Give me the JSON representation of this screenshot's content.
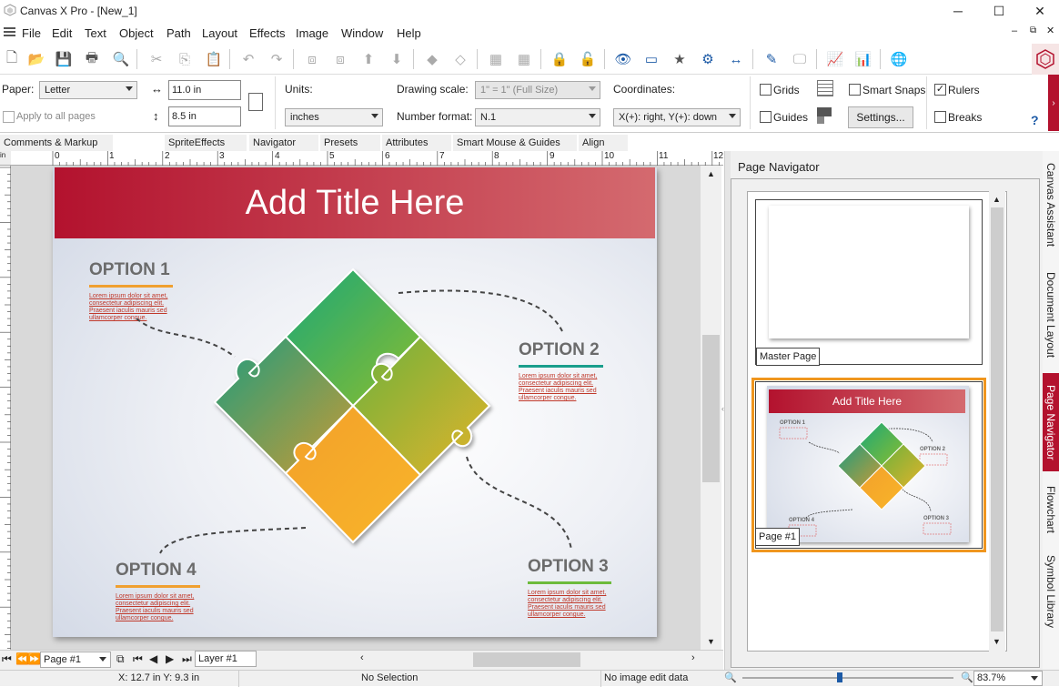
{
  "app": {
    "title": "Canvas X Pro - [New_1]"
  },
  "menu": [
    "File",
    "Edit",
    "Text",
    "Object",
    "Path",
    "Layout",
    "Effects",
    "Image",
    "Window",
    "Help"
  ],
  "props": {
    "paper_label": "Paper:",
    "paper_value": "Letter",
    "width_value": "11.0 in",
    "height_value": "8.5 in",
    "apply_all": "Apply to all pages",
    "units_label": "Units:",
    "units_value": "inches",
    "drawing_scale_label": "Drawing scale:",
    "drawing_scale_value": "1\" = 1\"  (Full Size)",
    "number_format_label": "Number format:",
    "number_format_value": "N.1",
    "coordinates_label": "Coordinates:",
    "coordinates_value": "X(+): right, Y(+): down",
    "grids": "Grids",
    "guides": "Guides",
    "smart_snaps": "Smart Snaps",
    "settings": "Settings...",
    "rulers": "Rulers",
    "breaks": "Breaks",
    "help": "?"
  },
  "panel_tabs": [
    "Comments & Markup",
    "SpriteEffects",
    "Navigator",
    "Presets",
    "Attributes",
    "Smart Mouse & Guides",
    "Align"
  ],
  "ruler_numbers": [
    "0",
    "1",
    "2",
    "3",
    "4",
    "5",
    "6",
    "7",
    "8",
    "9",
    "10",
    "11",
    "12"
  ],
  "slide": {
    "title": "Add Title Here",
    "option1": "OPTION 1",
    "option2": "OPTION 2",
    "option3": "OPTION 3",
    "option4": "OPTION 4",
    "lorem1": "Lorem ipsum dolor sit amet, consectetur adipiscing elit. Praesent iaculis mauris sed ullamcorper congue.",
    "lorem2": "Lorem ipsum dolor sit amet, consectetur adipiscing elit. Praesent iaculis mauris sed ullamcorper congue.",
    "lorem3": "Lorem ipsum dolor sit amet, consectetur adipiscing elit. Praesent iaculis mauris sed ullamcorper congue.",
    "lorem4": "Lorem ipsum dolor sit amet, consectetur adipiscing elit. Praesent iaculis mauris sed ullamcorper congue."
  },
  "bottom": {
    "page": "Page #1",
    "layer": "Layer #1"
  },
  "status": {
    "coords": "X: 12.7 in Y: 9.3 in",
    "selection": "No Selection",
    "image_edit": "No image edit data",
    "zoom": "83.7%"
  },
  "navigator": {
    "title": "Page Navigator",
    "master_label": "Master Page",
    "page1_label": "Page #1",
    "thumb_title": "Add Title Here",
    "thumb_opt1": "OPTION 1",
    "thumb_opt2": "OPTION 2",
    "thumb_opt3": "OPTION 3",
    "thumb_opt4": "OPTION 4"
  },
  "side_tabs": [
    "Canvas Assistant",
    "Document Layout",
    "Page Navigator",
    "Flowchart",
    "Symbol Library"
  ],
  "colors": {
    "accent": "#b3122e",
    "title_grad_end": "#d46a6f",
    "selected_border": "#f0961e",
    "opt1_line": "#f0a030",
    "opt2_line": "#1a9e8c",
    "opt3_line": "#6dbb3c",
    "opt4_line": "#f0a030"
  }
}
